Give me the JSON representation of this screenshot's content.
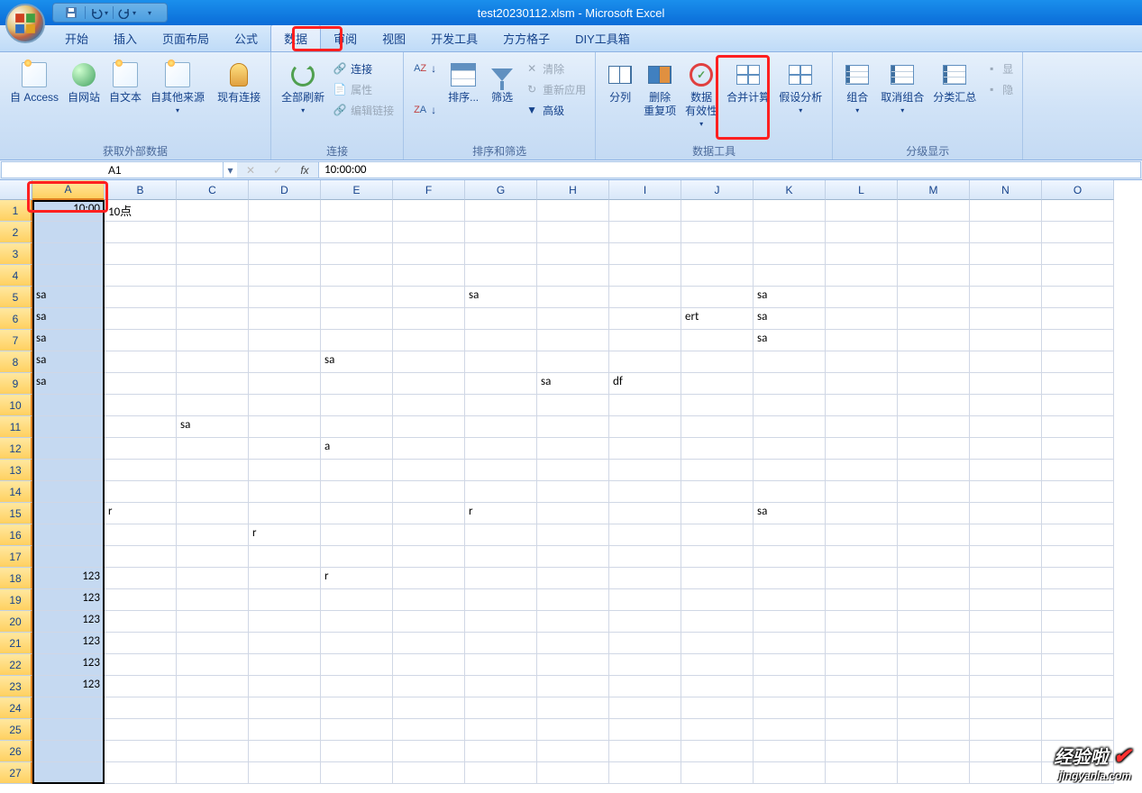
{
  "title": "test20230112.xlsm - Microsoft Excel",
  "tabs": {
    "t0": "开始",
    "t1": "插入",
    "t2": "页面布局",
    "t3": "公式",
    "t4": "数据",
    "t5": "审阅",
    "t6": "视图",
    "t7": "开发工具",
    "t8": "方方格子",
    "t9": "DIY工具箱"
  },
  "ribbon": {
    "ext": {
      "access": "自 Access",
      "web": "自网站",
      "text": "自文本",
      "other": "自其他来源",
      "existing": "现有连接",
      "label": "获取外部数据"
    },
    "conn": {
      "refresh": "全部刷新",
      "c1": "连接",
      "c2": "属性",
      "c3": "编辑链接",
      "label": "连接"
    },
    "sort": {
      "sort": "排序...",
      "filter": "筛选",
      "clear": "清除",
      "reapply": "重新应用",
      "adv": "高级",
      "label": "排序和筛选"
    },
    "tools": {
      "split": "分列",
      "dedup1": "删除",
      "dedup2": "重复项",
      "valid1": "数据",
      "valid2": "有效性",
      "merge": "合并计算",
      "whatif": "假设分析",
      "label": "数据工具"
    },
    "outline": {
      "group": "组合",
      "ungroup": "取消组合",
      "subtotal": "分类汇总",
      "show": "显",
      "hide": "隐",
      "label": "分级显示"
    }
  },
  "namebox": "A1",
  "formula": "10:00:00",
  "columns": [
    "A",
    "B",
    "C",
    "D",
    "E",
    "F",
    "G",
    "H",
    "I",
    "J",
    "K",
    "L",
    "M",
    "N",
    "O"
  ],
  "rows": [
    "1",
    "2",
    "3",
    "4",
    "5",
    "6",
    "7",
    "8",
    "9",
    "10",
    "11",
    "12",
    "13",
    "14",
    "15",
    "16",
    "17",
    "18",
    "19",
    "20",
    "21",
    "22",
    "23",
    "24",
    "25",
    "26",
    "27"
  ],
  "cells": {
    "A1": "10:00",
    "B1": "10点",
    "A5": "sa",
    "G5": "sa",
    "K5": "sa",
    "A6": "sa",
    "J6": "ert",
    "K6": "sa",
    "A7": "sa",
    "K7": "sa",
    "A8": "sa",
    "E8": "sa",
    "A9": "sa",
    "H9": "sa",
    "I9": "df",
    "C11": "sa",
    "E12": "a",
    "B15": "r",
    "G15": "r",
    "K15": "sa",
    "D16": "r",
    "A18": "123",
    "E18": "r",
    "A19": "123",
    "A20": "123",
    "A21": "123",
    "A22": "123",
    "A23": "123"
  },
  "watermark": {
    "line1": "经验啦",
    "line2": "jingyanla.com"
  }
}
